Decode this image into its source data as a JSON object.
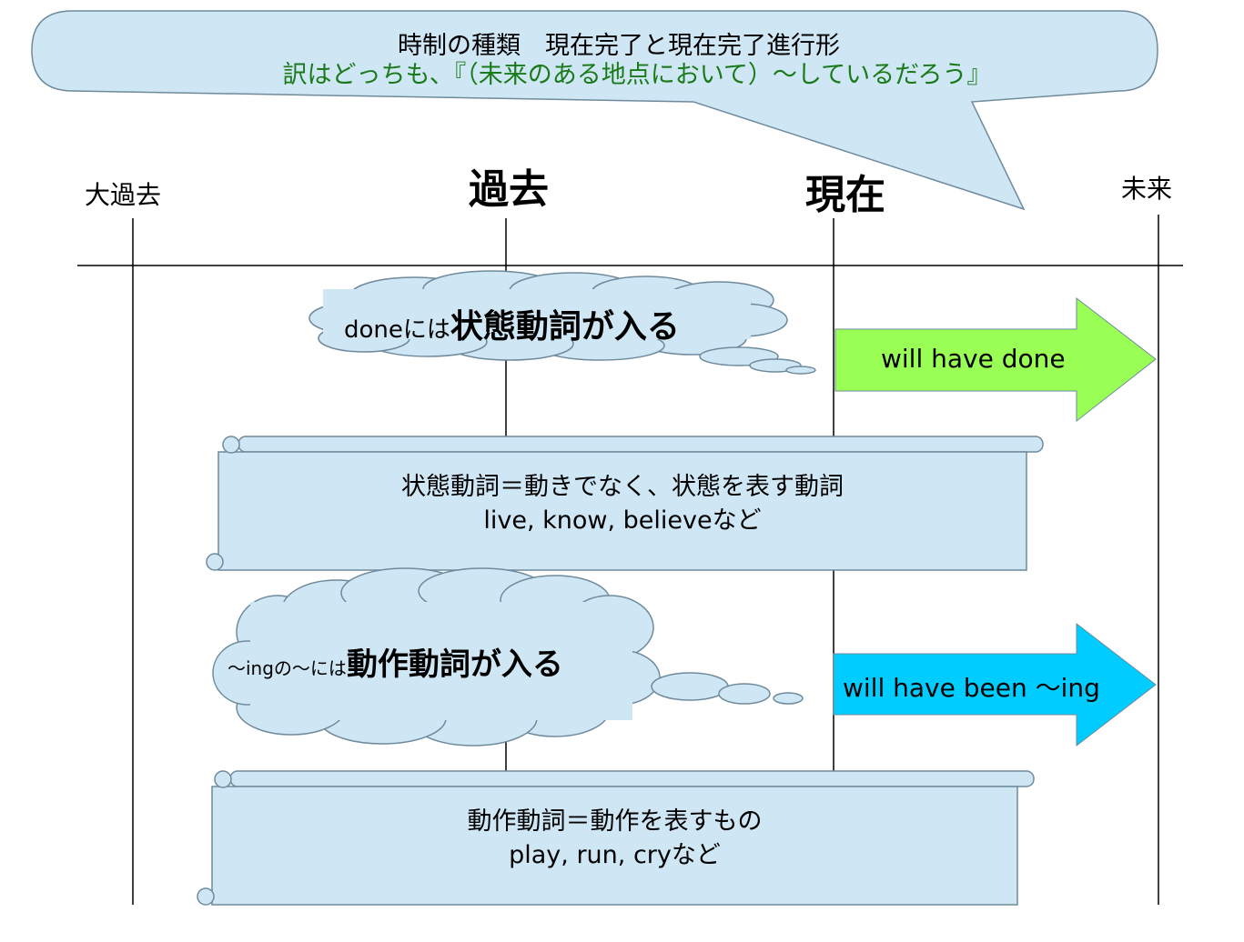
{
  "bubble": {
    "line1": "時制の種類　現在完了と現在完了進行形",
    "line2": "訳はどっちも、『（未来のある地点において）～しているだろう』"
  },
  "timeline": {
    "daikako": "大過去",
    "kako": "過去",
    "genzai": "現在",
    "mirai": "未来"
  },
  "cloud1": {
    "prefix": "doneには",
    "bold": "状態動詞が入る"
  },
  "arrow1": {
    "label": "will have done",
    "color": "#99ff55"
  },
  "scroll1": {
    "line1": "状態動詞＝動きでなく、状態を表す動詞",
    "line2": "live,  know,  believeなど"
  },
  "cloud2": {
    "prefix": "～ingの～には",
    "bold": "動作動詞が入る"
  },
  "arrow2": {
    "label": "will have been ～ing",
    "color": "#00ccff"
  },
  "scroll2": {
    "line1": "動作動詞＝動作を表すもの",
    "line2": "play, run, cryなど"
  },
  "colors": {
    "shape_fill": "#cfe7f5",
    "outline": "#6e8a9c",
    "line": "#000000"
  }
}
